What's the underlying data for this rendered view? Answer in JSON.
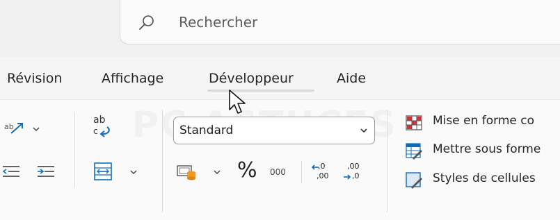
{
  "search": {
    "placeholder": "Rechercher"
  },
  "tabs": [
    {
      "label": "Révision"
    },
    {
      "label": "Affichage"
    },
    {
      "label": "Développeur"
    },
    {
      "label": "Aide"
    }
  ],
  "number": {
    "format_value": "Standard",
    "percent_symbol": "%",
    "thousands_symbol": "000",
    "inc_decimal_top": ",0",
    "inc_decimal_bottom": ",00",
    "dec_decimal_top": ",00",
    "dec_decimal_bottom": ",0"
  },
  "alignment": {
    "wrap_text_symbol": "ab"
  },
  "styles": {
    "conditional_format": "Mise en forme co",
    "format_as_table": "Mettre sous forme",
    "cell_styles": "Styles de cellules"
  },
  "colors": {
    "accent": "#0f6cbd",
    "red": "#d13438",
    "orange": "#f29a1f"
  }
}
